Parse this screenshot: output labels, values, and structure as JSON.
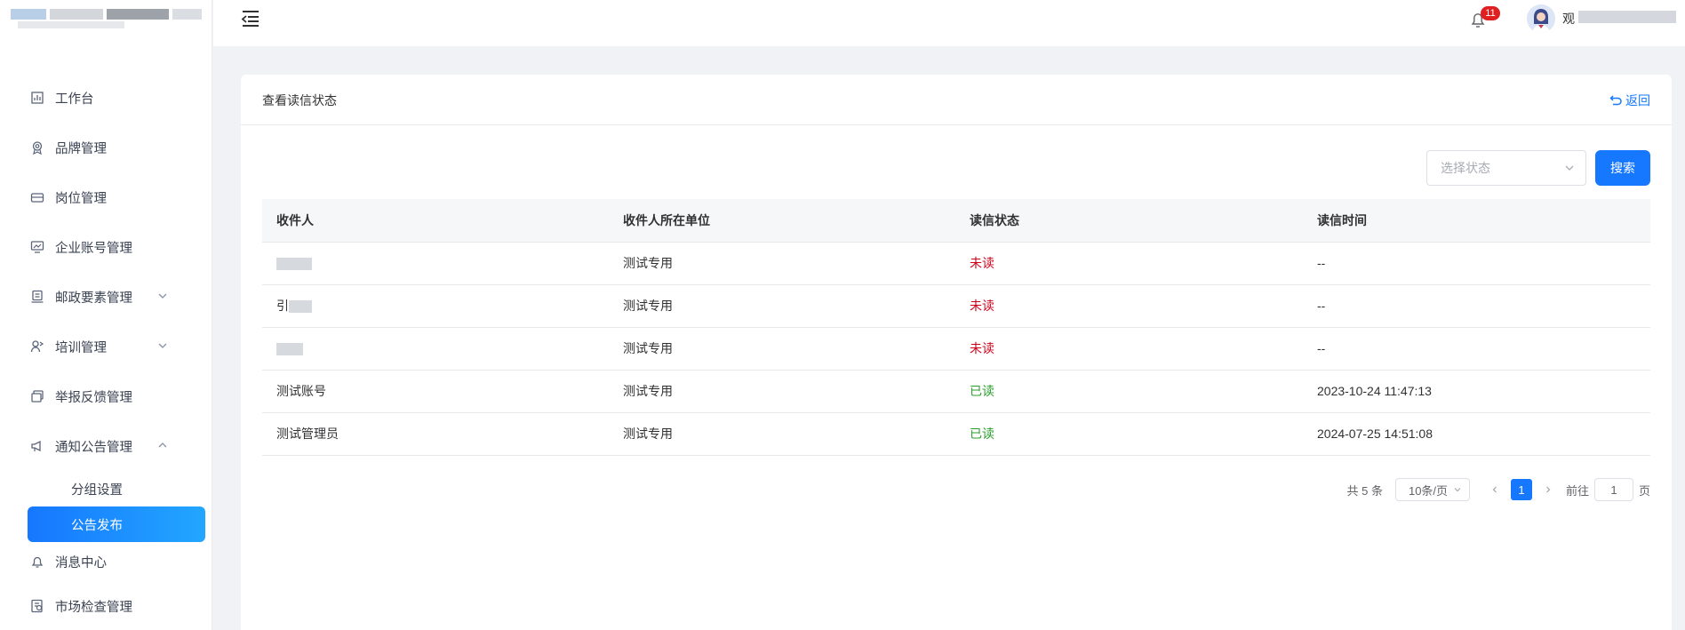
{
  "menu": {
    "items": [
      {
        "label": "工作台",
        "icon": "dashboard-icon"
      },
      {
        "label": "品牌管理",
        "icon": "brand-icon"
      },
      {
        "label": "岗位管理",
        "icon": "position-icon"
      },
      {
        "label": "企业账号管理",
        "icon": "account-icon"
      },
      {
        "label": "邮政要素管理",
        "icon": "postal-icon"
      },
      {
        "label": "培训管理",
        "icon": "training-icon"
      },
      {
        "label": "举报反馈管理",
        "icon": "report-icon"
      },
      {
        "label": "通知公告管理",
        "icon": "notice-icon"
      }
    ],
    "sub_items": [
      {
        "label": "分组设置"
      },
      {
        "label": "公告发布"
      }
    ],
    "after_items": [
      {
        "label": "消息中心",
        "icon": "bell-icon"
      },
      {
        "label": "市场检查管理",
        "icon": "inspect-icon"
      }
    ]
  },
  "header": {
    "badge_count": "11",
    "user_initial": "观"
  },
  "card": {
    "title": "查看读信状态",
    "back_label": "返回"
  },
  "filter": {
    "status_placeholder": "选择状态",
    "search_label": "搜索"
  },
  "table": {
    "headers": [
      "收件人",
      "收件人所在单位",
      "读信状态",
      "读信时间"
    ],
    "rows": [
      {
        "recipient": "",
        "unit": "测试专用",
        "status": "未读",
        "time": "--"
      },
      {
        "recipient": "引",
        "unit": "测试专用",
        "status": "未读",
        "time": "--"
      },
      {
        "recipient": "",
        "unit": "测试专用",
        "status": "未读",
        "time": "--"
      },
      {
        "recipient": "测试账号",
        "unit": "测试专用",
        "status": "已读",
        "time": "2023-10-24 11:47:13"
      },
      {
        "recipient": "测试管理员",
        "unit": "测试专用",
        "status": "已读",
        "time": "2024-07-25 14:51:08"
      }
    ]
  },
  "pagination": {
    "total_text": "共 5 条",
    "page_size": "10条/页",
    "current_page": "1",
    "goto_prefix": "前往",
    "goto_value": "1",
    "goto_suffix": "页"
  },
  "colors": {
    "primary": "#1677ff",
    "unread": "#d0021b",
    "read": "#2aa02a"
  }
}
